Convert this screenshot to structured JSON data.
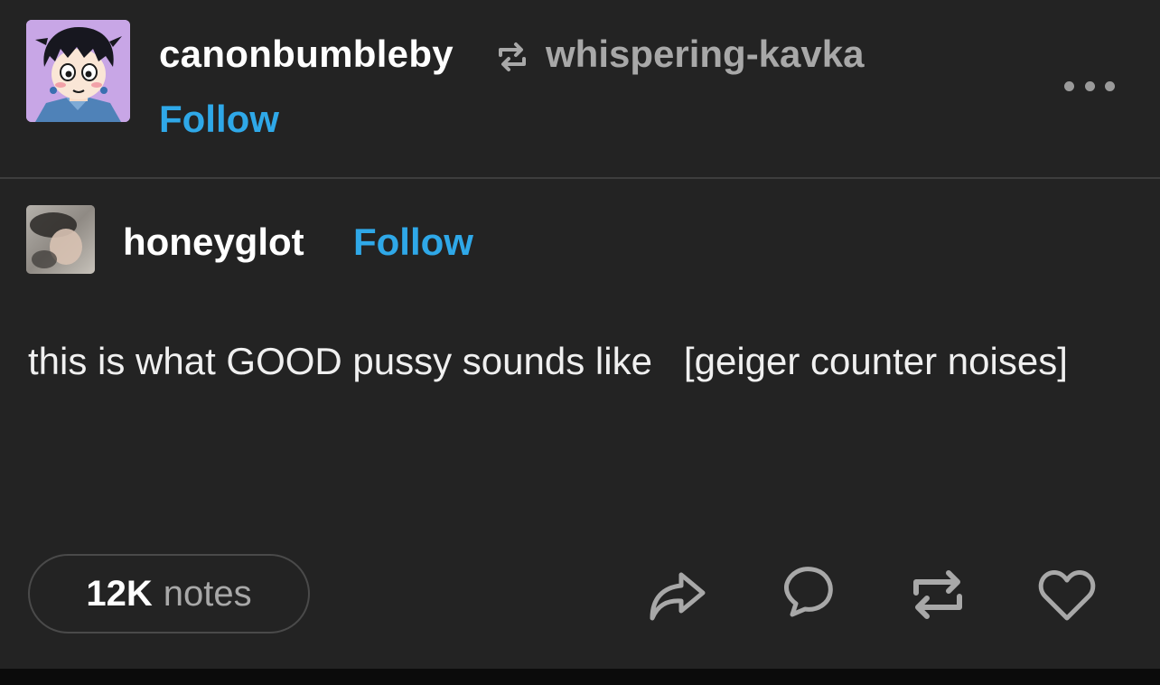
{
  "header": {
    "poster_name": "canonbumbleby",
    "source_name": "whispering-kavka",
    "follow_label": "Follow",
    "avatar_icon": "anime-boy-avatar",
    "reblog_icon": "reblog-icon",
    "more_icon": "ellipsis-icon"
  },
  "trail": {
    "author_name": "honeyglot",
    "follow_label": "Follow",
    "avatar_icon": "photo-avatar",
    "body": "this is what GOOD pussy sounds like   [geiger counter noises]"
  },
  "footer": {
    "notes_count": "12K",
    "notes_label": "notes",
    "actions": [
      "share-icon",
      "reply-icon",
      "reblog-icon",
      "like-icon"
    ]
  },
  "colors": {
    "background": "#232323",
    "accent": "#2fa8e8",
    "primary_text": "#ffffff",
    "secondary_text": "#a8a8a8",
    "divider": "#3d3d3d"
  }
}
